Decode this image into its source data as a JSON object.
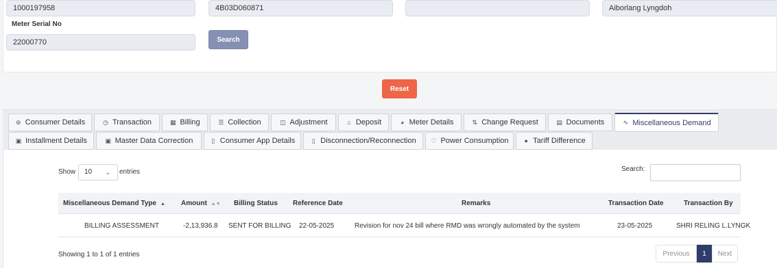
{
  "form": {
    "consumer_no": "1000197958",
    "meter_id": "4B03D060871",
    "blank_field": "",
    "consumer_name": "Aiborlang Lyngdoh",
    "meter_serial_label": "Meter Serial No",
    "meter_serial_value": "22000770",
    "search_label": "Search",
    "reset_label": "Reset"
  },
  "tabs_row1": [
    {
      "label": "Consumer Details",
      "icon": "⊚"
    },
    {
      "label": "Transaction",
      "icon": "◷"
    },
    {
      "label": "Billing",
      "icon": "▦"
    },
    {
      "label": "Collection",
      "icon": "☰"
    },
    {
      "label": "Adjustment",
      "icon": "◫"
    },
    {
      "label": "Deposit",
      "icon": "⌂"
    },
    {
      "label": "Meter Details",
      "icon": "◕"
    },
    {
      "label": "Change Request",
      "icon": "⇅"
    },
    {
      "label": "Documents",
      "icon": "▤"
    },
    {
      "label": "Miscellaneous Demand",
      "icon": "∿"
    }
  ],
  "tabs_row2": [
    {
      "label": "Installment Details",
      "icon": "▣"
    },
    {
      "label": "Master Data Correction",
      "icon": "▣"
    },
    {
      "label": "Consumer App Details",
      "icon": "▯"
    },
    {
      "label": "Disconnection/Reconnection",
      "icon": "▯"
    },
    {
      "label": "Power Consumption",
      "icon": "♡"
    },
    {
      "label": "Tariff Difference",
      "icon": "●"
    }
  ],
  "table": {
    "show_label": "Show",
    "entries_value": "10",
    "entries_label": "entries",
    "search_label": "Search:",
    "columns": [
      "Miscellaneous Demand Type",
      "Amount",
      "Billing Status",
      "Reference Date",
      "Remarks",
      "Transaction Date",
      "Transaction By"
    ],
    "rows": [
      [
        "BILLING ASSESSMENT",
        "-2,13,936.8",
        "SENT FOR BILLING",
        "22-05-2025",
        "Revision for nov 24 bill where RMD was wrongly automated by the system",
        "23-05-2025",
        "SHRI RELING L.LYNGK"
      ]
    ],
    "info": "Showing 1 to 1 of 1 entries",
    "pager": {
      "previous": "Previous",
      "current": "1",
      "next": "Next"
    }
  }
}
